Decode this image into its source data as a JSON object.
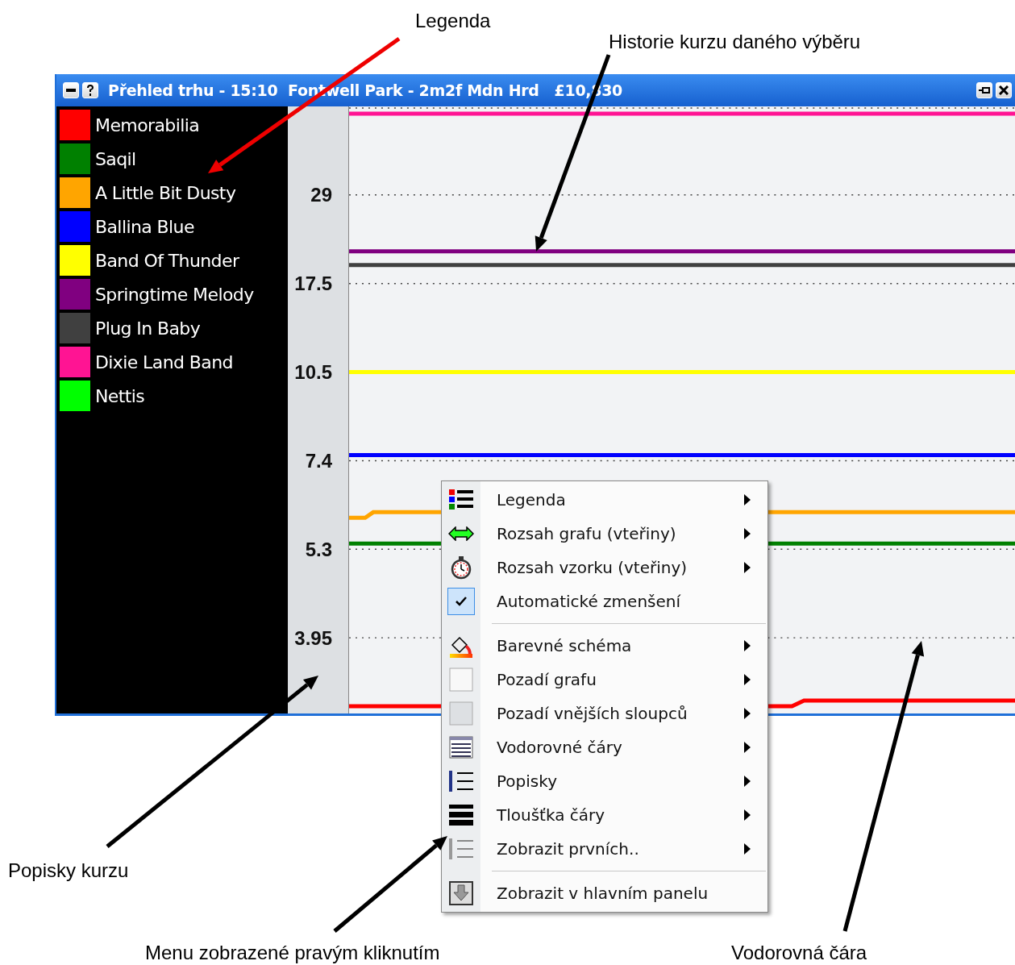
{
  "annotations": [
    {
      "text": "Legenda"
    },
    {
      "text": "Historie kurzu daného výběru"
    },
    {
      "text": "Popisky kurzu"
    },
    {
      "text": "Menu zobrazené pravým kliknutím"
    },
    {
      "text": "Vodorovná čára"
    }
  ],
  "window": {
    "title": "Přehled trhu - 15:10  Fontwell Park - 2m2f Mdn Hrd   £10,830"
  },
  "legend": [
    {
      "name": "Memorabilia",
      "color": "#ff0000"
    },
    {
      "name": "Saqil",
      "color": "#008000"
    },
    {
      "name": "A Little Bit Dusty",
      "color": "#ffa500"
    },
    {
      "name": "Ballina Blue",
      "color": "#0000ff"
    },
    {
      "name": "Band Of Thunder",
      "color": "#ffff00"
    },
    {
      "name": "Springtime Melody",
      "color": "#800080"
    },
    {
      "name": "Plug In Baby",
      "color": "#404040"
    },
    {
      "name": "Dixie Land Band",
      "color": "#ff1493"
    },
    {
      "name": "Nettis",
      "color": "#00ff00"
    }
  ],
  "axis_labels": [
    "29",
    "17.5",
    "10.5",
    "7.4",
    "5.3",
    "3.95"
  ],
  "context_menu": [
    {
      "kind": "item",
      "label": "Legenda",
      "submenu": true
    },
    {
      "kind": "item",
      "label": "Rozsah grafu (vteřiny)",
      "submenu": true
    },
    {
      "kind": "item",
      "label": "Rozsah vzorku (vteřiny)",
      "submenu": true
    },
    {
      "kind": "check",
      "label": "Automatické zmenšení",
      "checked": true
    },
    {
      "kind": "separator"
    },
    {
      "kind": "item",
      "label": "Barevné schéma",
      "submenu": true
    },
    {
      "kind": "item",
      "label": "Pozadí grafu",
      "submenu": true
    },
    {
      "kind": "item",
      "label": "Pozadí vnějších sloupců",
      "submenu": true
    },
    {
      "kind": "item",
      "label": "Vodorovné čáry",
      "submenu": true
    },
    {
      "kind": "item",
      "label": "Popisky",
      "submenu": true
    },
    {
      "kind": "item",
      "label": "Tloušťka čáry",
      "submenu": true
    },
    {
      "kind": "item",
      "label": "Zobrazit prvních..",
      "submenu": true
    },
    {
      "kind": "separator"
    },
    {
      "kind": "item",
      "label": "Zobrazit v hlavním panelu",
      "submenu": false
    }
  ]
}
